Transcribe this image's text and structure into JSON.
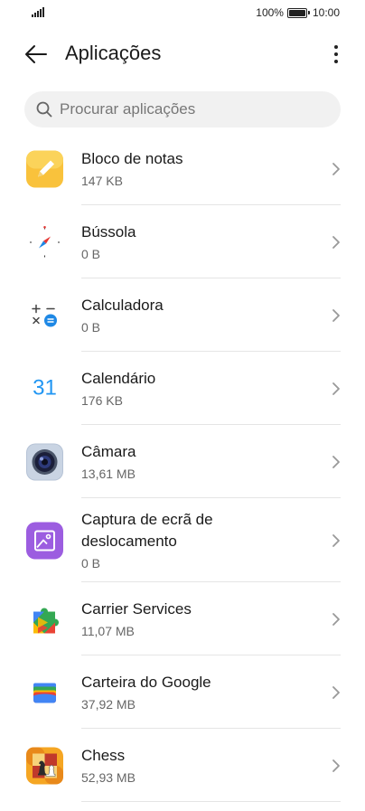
{
  "status_bar": {
    "battery_percent": "100%",
    "time": "10:00"
  },
  "header": {
    "title": "Aplicações"
  },
  "search": {
    "placeholder": "Procurar aplicações"
  },
  "apps": [
    {
      "name": "Bloco de notas",
      "size": "147 KB",
      "icon": "notepad-icon"
    },
    {
      "name": "Bússola",
      "size": "0 B",
      "icon": "compass-icon"
    },
    {
      "name": "Calculadora",
      "size": "0 B",
      "icon": "calculator-icon"
    },
    {
      "name": "Calendário",
      "size": "176 KB",
      "icon": "calendar-icon",
      "icon_text": "31"
    },
    {
      "name": "Câmara",
      "size": "13,61 MB",
      "icon": "camera-icon"
    },
    {
      "name": "Captura de ecrã de deslocamento",
      "size": "0 B",
      "icon": "scrolling-screenshot-icon"
    },
    {
      "name": "Carrier Services",
      "size": "11,07 MB",
      "icon": "carrier-services-icon"
    },
    {
      "name": "Carteira do Google",
      "size": "37,92 MB",
      "icon": "google-wallet-icon"
    },
    {
      "name": "Chess",
      "size": "52,93 MB",
      "icon": "chess-icon"
    }
  ],
  "colors": {
    "divider": "#e5e5e5",
    "search_bg": "#f1f1f1",
    "calendar_blue": "#2196f3"
  }
}
